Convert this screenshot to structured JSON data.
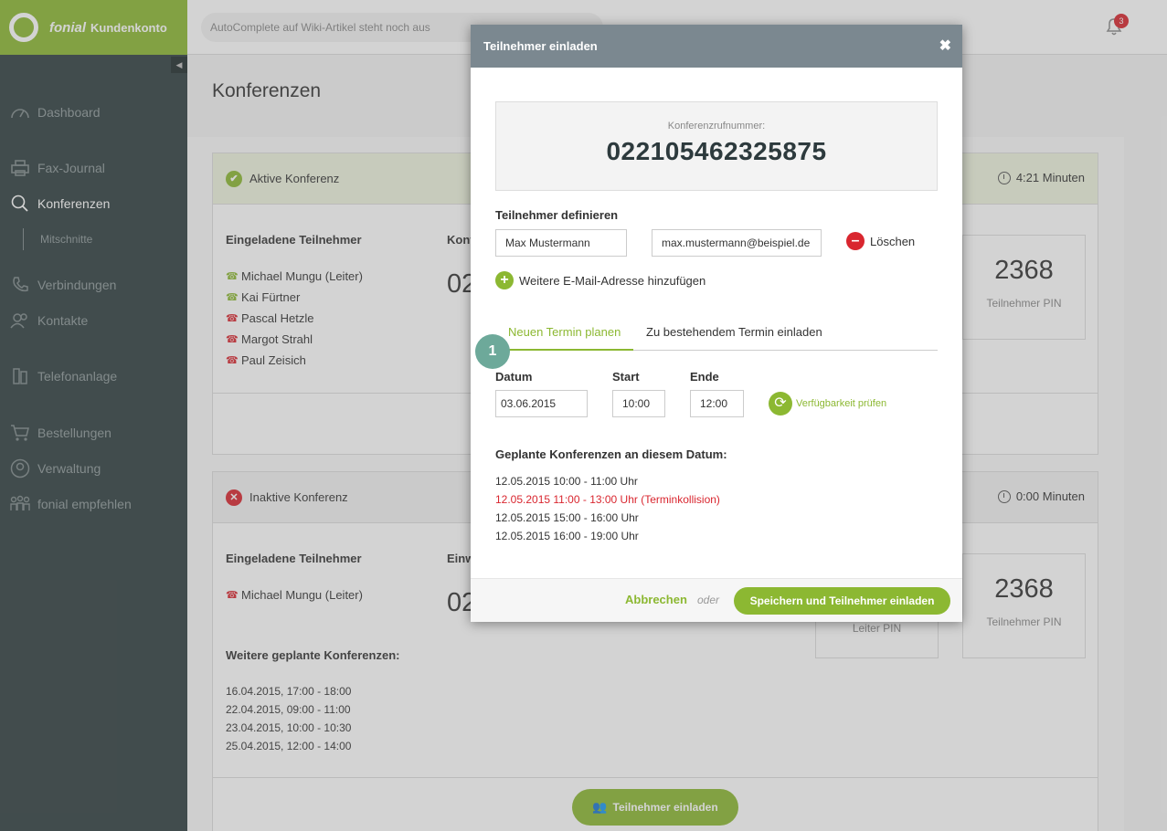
{
  "brand": {
    "name": "fonial",
    "product": "Kundenkonto",
    "color": "#8cb832"
  },
  "search": {
    "placeholder": "AutoComplete auf Wiki-Artikel steht noch aus"
  },
  "notifications": {
    "count": "3"
  },
  "sidebar": {
    "items": [
      {
        "label": "Dashboard",
        "icon": "speedometer-icon"
      },
      {
        "label": "Fax-Journal",
        "icon": "printer-icon"
      },
      {
        "label": "Konferenzen",
        "icon": "chat-search-icon",
        "active": true
      },
      {
        "label": "Mitschnitte",
        "sub": true
      },
      {
        "label": "Verbindungen",
        "icon": "phone-icon"
      },
      {
        "label": "Kontakte",
        "icon": "contacts-icon"
      },
      {
        "label": "Telefonanlage",
        "icon": "pbx-icon"
      },
      {
        "label": "Bestellungen",
        "icon": "cart-icon"
      },
      {
        "label": "Verwaltung",
        "icon": "user-circle-icon"
      },
      {
        "label": "fonial empfehlen",
        "icon": "people-icon"
      }
    ]
  },
  "page": {
    "title": "Konferenzen"
  },
  "active_conf": {
    "status": "Aktive Konferenz",
    "duration": "4:21 Minuten",
    "invited_heading": "Eingeladene Teilnehmer",
    "col2_heading_partial": "Konf",
    "big_partial": "02",
    "participants": [
      {
        "name": "Michael Mungu (Leiter)",
        "state": "connected"
      },
      {
        "name": "Kai Fürtner",
        "state": "connected"
      },
      {
        "name": "Pascal Hetzle",
        "state": "disconnected"
      },
      {
        "name": "Margot Strahl",
        "state": "disconnected"
      },
      {
        "name": "Paul Zeisich",
        "state": "disconnected"
      }
    ],
    "pin": {
      "value": "2368",
      "label": "Teilnehmer PIN"
    }
  },
  "inactive_conf": {
    "status": "Inaktive Konferenz",
    "duration": "0:00 Minuten",
    "invited_heading": "Eingeladene Teilnehmer",
    "col2_heading_partial": "Einw",
    "big_partial": "02",
    "participants": [
      {
        "name": "Michael Mungu (Leiter)",
        "state": "disconnected"
      }
    ],
    "leader_pin_label": "Leiter PIN",
    "pin": {
      "value": "2368",
      "label": "Teilnehmer PIN"
    },
    "more_heading": "Weitere geplante Konferenzen:",
    "more_dates": [
      "16.04.2015, 17:00 - 18:00",
      "22.04.2015, 09:00 - 11:00",
      "23.04.2015, 10:00 - 10:30",
      "25.04.2015, 12:00 - 14:00"
    ]
  },
  "invite_button": "Teilnehmer einladen",
  "modal": {
    "title": "Teilnehmer einladen",
    "close": "✖",
    "number_label": "Konferenzrufnummer:",
    "number": "022105462325875",
    "define_heading": "Teilnehmer definieren",
    "name_value": "Max Mustermann",
    "email_value": "max.mustermann@beispiel.de",
    "delete_label": "Löschen",
    "add_email_label": "Weitere E-Mail-Adresse hinzufügen",
    "tabs": [
      "Neuen Termin planen",
      "Zu bestehendem Termin einladen"
    ],
    "step": "1",
    "date_label": "Datum",
    "start_label": "Start",
    "end_label": "Ende",
    "date_value": "03.06.2015",
    "start_value": "10:00",
    "end_value": "12:00",
    "check_label": "Verfügbarkeit prüfen",
    "planned_heading": "Geplante Konferenzen an diesem Datum:",
    "planned": [
      {
        "text": "12.05.2015 10:00 - 11:00 Uhr",
        "conflict": false
      },
      {
        "text": "12.05.2015 11:00 - 13:00 Uhr (Terminkollision)",
        "conflict": true
      },
      {
        "text": "12.05.2015 15:00 - 16:00 Uhr",
        "conflict": false
      },
      {
        "text": "12.05.2015 16:00 - 19:00 Uhr",
        "conflict": false
      }
    ],
    "cancel_label": "Abbrechen",
    "or_label": "oder",
    "save_label": "Speichern und Teilnehmer einladen"
  }
}
